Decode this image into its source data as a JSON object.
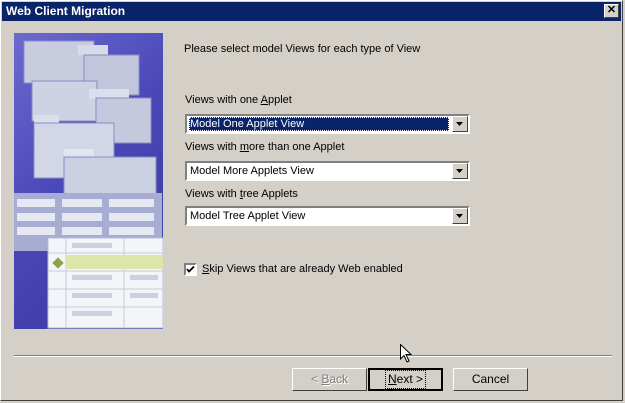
{
  "window": {
    "title": "Web Client Migration",
    "close_glyph": "✕"
  },
  "prompt": "Please select model Views for each type of View",
  "fields": [
    {
      "label_pre": "Views with one ",
      "label_accel": "A",
      "label_post": "pplet",
      "value": "Model One Applet View",
      "focused": true
    },
    {
      "label_pre": "Views with ",
      "label_accel": "m",
      "label_post": "ore than one Applet",
      "value": "Model More Applets View",
      "focused": false
    },
    {
      "label_pre": "Views with ",
      "label_accel": "t",
      "label_post": "ree Applets",
      "value": "Model Tree Applet View",
      "focused": false
    }
  ],
  "skip_option": {
    "accel": "S",
    "rest": "kip Views that are already Web enabled",
    "checked": true
  },
  "buttons": {
    "back": {
      "prefix": "< ",
      "accel": "B",
      "rest": "ack",
      "disabled": true
    },
    "next": {
      "accel": "N",
      "rest": "ext >",
      "default": true
    },
    "cancel": {
      "label": "Cancel"
    }
  },
  "colors": {
    "titlebar": "#0a246a",
    "face": "#d4d0c8",
    "selection": "#0a246a"
  },
  "icons": {
    "close": "close-icon",
    "dropdown": "chevron-down-icon",
    "check": "checkmark-icon",
    "cursor": "mouse-cursor-icon"
  }
}
